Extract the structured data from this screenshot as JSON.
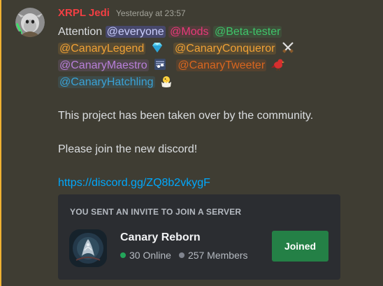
{
  "author": {
    "name": "XRPL Jedi",
    "timestamp": "Yesterday at 23:57",
    "name_color": "#f23f43"
  },
  "message": {
    "intro": "Attention",
    "mentions": {
      "everyone": "@everyone",
      "mods": "@Mods",
      "beta": "@Beta-tester",
      "legend": "@CanaryLegend",
      "conqueror": "@CanaryConqueror",
      "maestro": "@CanaryMaestro",
      "tweeter": "@CanaryTweeter",
      "hatchling": "@CanaryHatchling"
    },
    "role_icons": {
      "legend": "diamond-icon",
      "conqueror": "crossed-swords-icon",
      "maestro": "music-notes-icon",
      "tweeter": "red-bird-icon",
      "hatchling": "hatching-chick-icon"
    },
    "line1": "This project has been taken over by the community.",
    "line2": "Please join the new discord!",
    "link": "https://discord.gg/ZQ8b2vkygF"
  },
  "invite": {
    "header": "YOU SENT AN INVITE TO JOIN A SERVER",
    "server_name": "Canary Reborn",
    "online": "30 Online",
    "members": "257 Members",
    "button_label": "Joined",
    "button_color": "#248046"
  },
  "colors": {
    "background": "#3f3d33",
    "highlight_bar": "#f0b232",
    "link": "#00a8fc",
    "card": "#2b2d31"
  }
}
